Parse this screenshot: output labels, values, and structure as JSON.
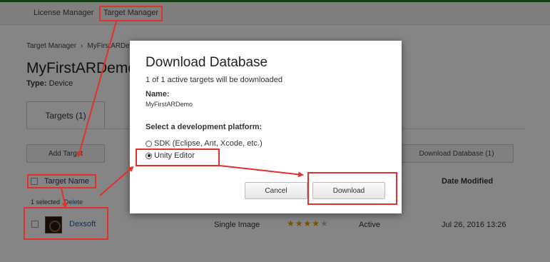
{
  "nav": {
    "tabs": [
      "License Manager",
      "Target Manager"
    ]
  },
  "breadcrumb": {
    "root": "Target Manager",
    "separator": "›",
    "current": "MyFirstARDe"
  },
  "page": {
    "title": "MyFirstARDemo",
    "type_label": "Type:",
    "type_value": "Device",
    "subtab": "Targets (1)",
    "add_target": "Add Target",
    "download_database": "Download Database (1)"
  },
  "table": {
    "header_name": "Target Name",
    "header_date": "Date Modified",
    "selected_text": "1 selected",
    "delete_text": "Delete",
    "rows": [
      {
        "name": "Dexsoft",
        "type": "Single Image",
        "rating": 4,
        "status": "Active",
        "date": "Jul 26, 2016 13:26"
      }
    ]
  },
  "modal": {
    "title": "Download Database",
    "count_text": "1 of 1 active targets will be downloaded",
    "name_label": "Name:",
    "name_value": "MyFirstARDemo",
    "platform_label": "Select a development platform:",
    "options": [
      {
        "label": "SDK (Eclipse, Ant, Xcode, etc.)",
        "selected": false
      },
      {
        "label": "Unity Editor",
        "selected": true
      }
    ],
    "cancel": "Cancel",
    "download": "Download"
  },
  "colors": {
    "annotation": "#e0312a",
    "link": "#1a5fa8",
    "accent": "#2c7a2c"
  }
}
